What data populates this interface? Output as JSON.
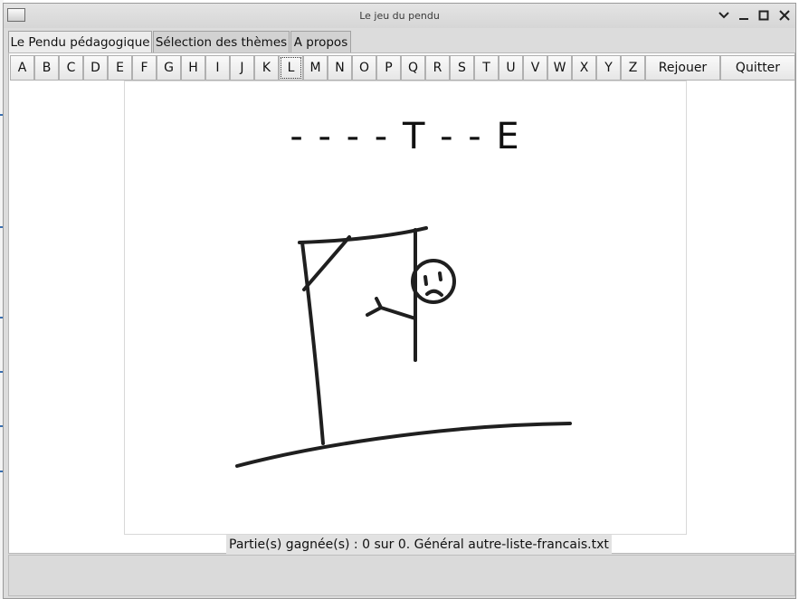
{
  "window": {
    "title": "Le jeu du pendu"
  },
  "tabs": [
    {
      "label": "Le Pendu pédagogique",
      "active": true
    },
    {
      "label": "Sélection des thèmes",
      "active": false
    },
    {
      "label": "A propos",
      "active": false
    }
  ],
  "keyboard": {
    "letters": [
      "A",
      "B",
      "C",
      "D",
      "E",
      "F",
      "G",
      "H",
      "I",
      "J",
      "K",
      "L",
      "M",
      "N",
      "O",
      "P",
      "Q",
      "R",
      "S",
      "T",
      "U",
      "V",
      "W",
      "X",
      "Y",
      "Z"
    ],
    "focused_letter": "L",
    "replay_label": "Rejouer",
    "quit_label": "Quitter"
  },
  "game": {
    "masked_word": "- - - - T - - E",
    "status_text": "Partie(s) gagnée(s) : 0 sur 0. Général autre-liste-francais.txt",
    "stroke_color": "#1f1f1f"
  },
  "icons": {
    "window": "window-icon",
    "minimize": "minimize-icon",
    "maximize": "maximize-icon",
    "close": "close-icon",
    "collapse": "chevron-down-icon"
  }
}
